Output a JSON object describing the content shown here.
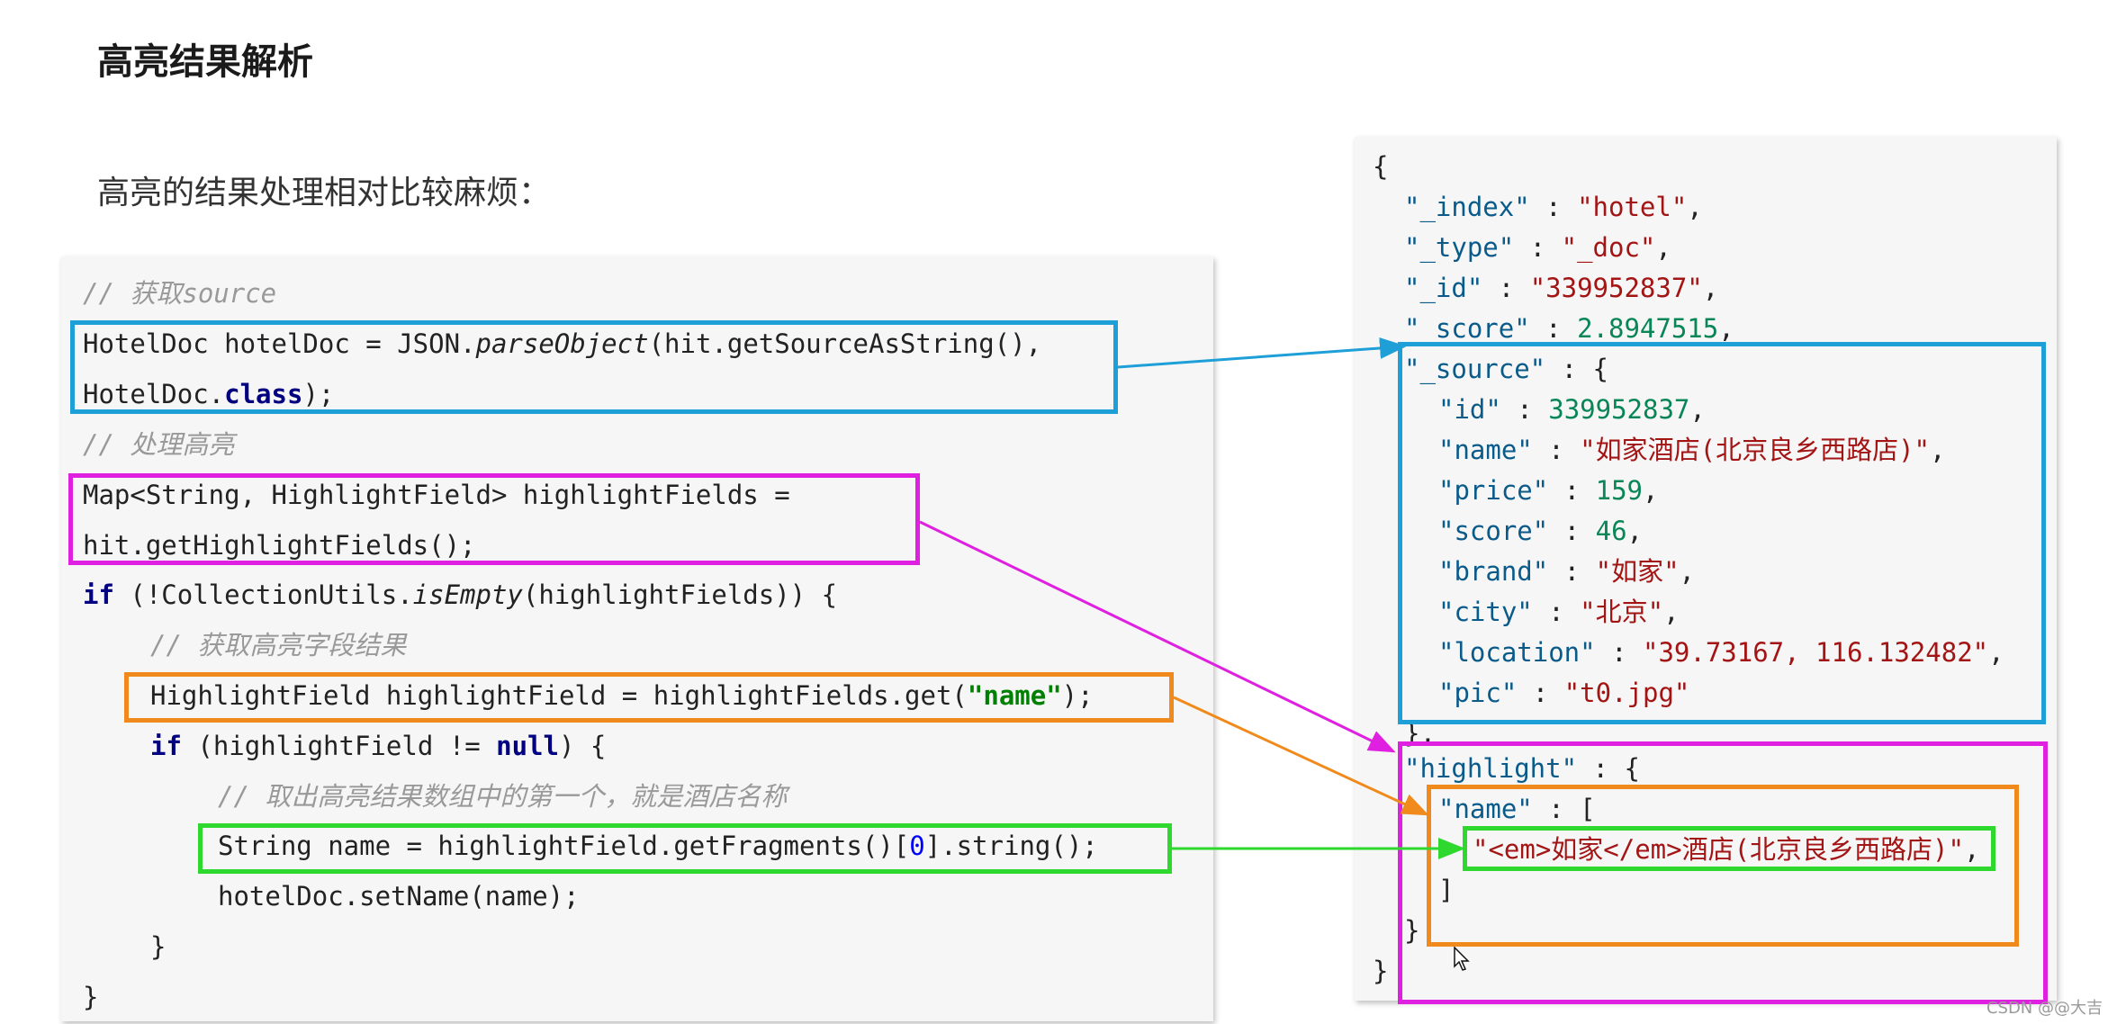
{
  "header": {
    "title": "高亮结果解析",
    "subtitle": "高亮的结果处理相对比较麻烦："
  },
  "code": {
    "comment_source": "// 获取source",
    "l1_a": "HotelDoc hotelDoc = JSON.",
    "l1_b": "parseObject",
    "l1_c": "(hit.getSourceAsString(),",
    "l2_a": "HotelDoc.",
    "l2_b": "class",
    "l2_c": ");",
    "comment_highlight": "// 处理高亮",
    "l3": "Map<String, HighlightField> highlightFields =",
    "l4": "hit.getHighlightFields();",
    "l5_a": "if",
    "l5_b": " (!CollectionUtils.",
    "l5_c": "isEmpty",
    "l5_d": "(highlightFields)) {",
    "comment_field": "// 获取高亮字段结果",
    "l6_a": "HighlightField highlightField = highlightFields.get(",
    "l6_b": "\"name\"",
    "l6_c": ");",
    "l7_a": "if",
    "l7_b": " (highlightField != ",
    "l7_c": "null",
    "l7_d": ") {",
    "comment_first": "// 取出高亮结果数组中的第一个，就是酒店名称",
    "l8_a": "String name = highlightField.getFragments()[",
    "l8_b": "0",
    "l8_c": "].string();",
    "l9": "hotelDoc.setName(name);",
    "l10": "}",
    "l11": "}"
  },
  "json": {
    "open": "{",
    "index_key": "\"_index\"",
    "index_val": "\"hotel\"",
    "type_key": "\"_type\"",
    "type_val": "\"_doc\"",
    "id_key": "\"_id\"",
    "id_val": "\"339952837\"",
    "score_key": "\"_score\"",
    "score_val": "2.8947515",
    "source_key": "\"_source\"",
    "src_id_key": "\"id\"",
    "src_id_val": "339952837",
    "src_name_key": "\"name\"",
    "src_name_val": "\"如家酒店(北京良乡西路店)\"",
    "src_price_key": "\"price\"",
    "src_price_val": "159",
    "src_score_key": "\"score\"",
    "src_score_val": "46",
    "src_brand_key": "\"brand\"",
    "src_brand_val": "\"如家\"",
    "src_city_key": "\"city\"",
    "src_city_val": "\"北京\"",
    "src_location_key": "\"location\"",
    "src_location_val": "\"39.73167, 116.132482\"",
    "src_pic_key": "\"pic\"",
    "src_pic_val": "\"t0.jpg\"",
    "source_close": "},",
    "highlight_key": "\"highlight\"",
    "hl_name_key": "\"name\"",
    "hl_name_val": "\"<em>如家</em>酒店(北京良乡西路店)\"",
    "array_close": "]",
    "obj_close": "}",
    "root_close": "}"
  },
  "watermark": "CSDN @@大吉",
  "colors": {
    "blue": "#1e9fd8",
    "magenta": "#e020e0",
    "orange": "#f08a1c",
    "green": "#2fd82f"
  }
}
